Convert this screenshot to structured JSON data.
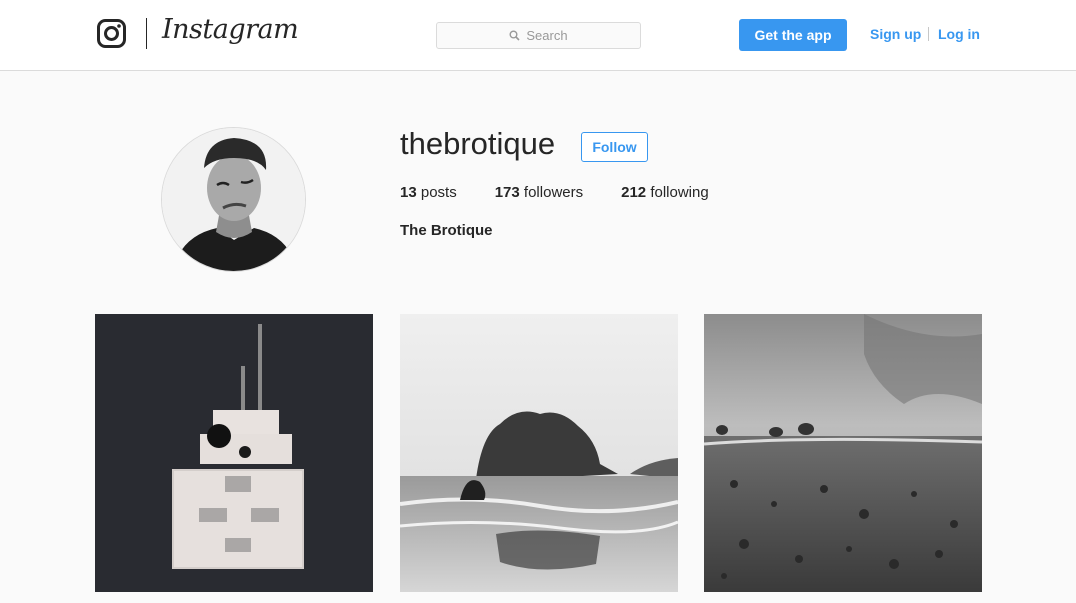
{
  "header": {
    "brand": "Instagram",
    "search_placeholder": "Search",
    "get_app_label": "Get the app",
    "signup_label": "Sign up",
    "login_label": "Log in",
    "accent_color": "#3897f0"
  },
  "profile": {
    "username": "thebrotique",
    "follow_label": "Follow",
    "posts_count": "13",
    "posts_label": "posts",
    "followers_count": "173",
    "followers_label": "followers",
    "following_count": "212",
    "following_label": "following",
    "full_name": "The Brotique"
  },
  "posts": [
    {
      "subject": "lego-robot"
    },
    {
      "subject": "foggy-island-seascape"
    },
    {
      "subject": "rocky-shore-landscape"
    }
  ]
}
